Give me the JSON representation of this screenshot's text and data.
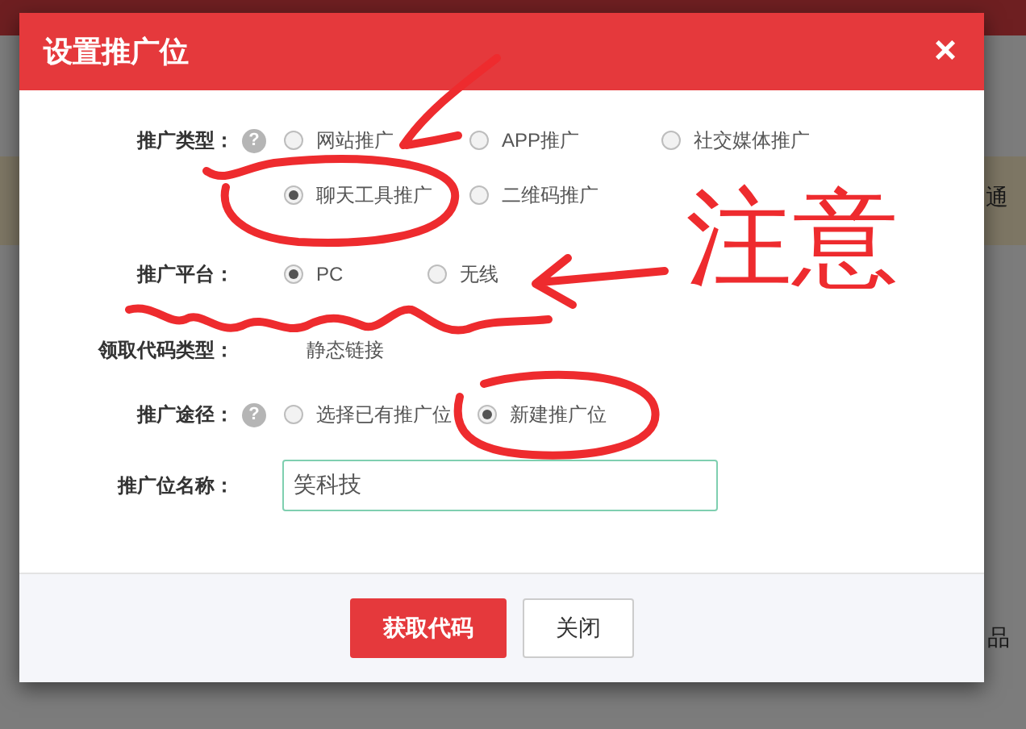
{
  "background": {
    "fragments": [
      "通",
      "品"
    ]
  },
  "dialog": {
    "title": "设置推广位",
    "close": "×",
    "fields": [
      {
        "kind": "radio",
        "label": "推广类型：",
        "help": "?",
        "options": [
          {
            "label": "网站推广",
            "selected": false
          },
          {
            "label": "APP推广",
            "selected": false
          },
          {
            "label": "社交媒体推广",
            "selected": false
          },
          {
            "label": "聊天工具推广",
            "selected": true
          },
          {
            "label": "二维码推广",
            "selected": false
          }
        ]
      },
      {
        "kind": "radio",
        "label": "推广平台：",
        "options": [
          {
            "label": "PC",
            "selected": true
          },
          {
            "label": "无线",
            "selected": false
          }
        ]
      },
      {
        "kind": "static",
        "label": "领取代码类型：",
        "value": "静态链接"
      },
      {
        "kind": "radio",
        "label": "推广途径：",
        "help": "?",
        "options": [
          {
            "label": "选择已有推广位",
            "selected": false
          },
          {
            "label": "新建推广位",
            "selected": true
          }
        ]
      },
      {
        "kind": "input",
        "label": "推广位名称：",
        "value": "笑科技"
      }
    ],
    "buttons": [
      {
        "label": "获取代码",
        "kind": "primary"
      },
      {
        "label": "关闭",
        "kind": "default"
      }
    ]
  },
  "annotation": {
    "note": "注意"
  }
}
